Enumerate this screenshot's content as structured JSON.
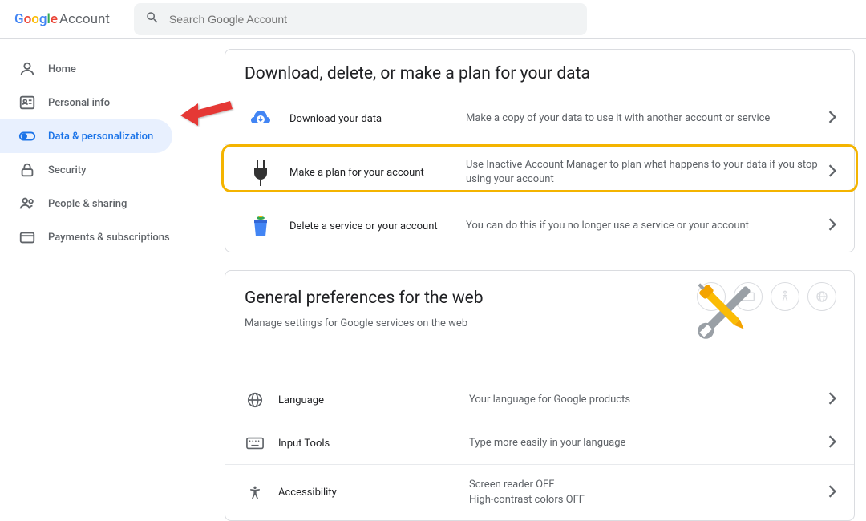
{
  "header": {
    "logo_account": "Account",
    "search_placeholder": "Search Google Account"
  },
  "sidebar": {
    "items": [
      {
        "label": "Home"
      },
      {
        "label": "Personal info"
      },
      {
        "label": "Data & personalization"
      },
      {
        "label": "Security"
      },
      {
        "label": "People & sharing"
      },
      {
        "label": "Payments & subscriptions"
      }
    ]
  },
  "data_card": {
    "title": "Download, delete, or make a plan for your data",
    "rows": [
      {
        "label": "Download your data",
        "desc": "Make a copy of your data to use it with another account or service"
      },
      {
        "label": "Make a plan for your account",
        "desc": "Use Inactive Account Manager to plan what happens to your data if you stop using your account"
      },
      {
        "label": "Delete a service or your account",
        "desc": "You can do this if you no longer use a service or your account"
      }
    ]
  },
  "pref_card": {
    "title": "General preferences for the web",
    "subtitle": "Manage settings for Google services on the web",
    "rows": [
      {
        "label": "Language",
        "desc": "Your language for Google products"
      },
      {
        "label": "Input Tools",
        "desc": "Type more easily in your language"
      },
      {
        "label": "Accessibility",
        "desc": "Screen reader OFF\nHigh-contrast colors OFF"
      }
    ]
  }
}
